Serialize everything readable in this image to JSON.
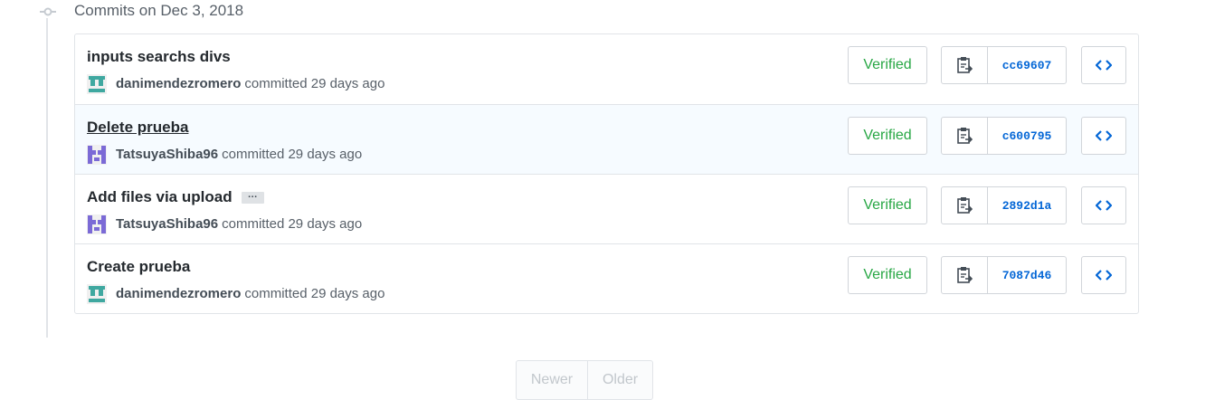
{
  "group": {
    "title": "Commits on Dec 3, 2018"
  },
  "commits": [
    {
      "message": "inputs searchs divs",
      "author": "danimendezromero",
      "committed": "committed 29 days ago",
      "verified": "Verified",
      "sha": "cc69607",
      "avatar_icon": "identicon-teal",
      "has_more": false,
      "highlighted": false
    },
    {
      "message": "Delete prueba",
      "author": "TatsuyaShiba96",
      "committed": "committed 29 days ago",
      "verified": "Verified",
      "sha": "c600795",
      "avatar_icon": "identicon-purple",
      "has_more": false,
      "highlighted": true
    },
    {
      "message": "Add files via upload",
      "author": "TatsuyaShiba96",
      "committed": "committed 29 days ago",
      "verified": "Verified",
      "sha": "2892d1a",
      "avatar_icon": "identicon-purple",
      "has_more": true,
      "more_label": "…",
      "highlighted": false
    },
    {
      "message": "Create prueba",
      "author": "danimendezromero",
      "committed": "committed 29 days ago",
      "verified": "Verified",
      "sha": "7087d46",
      "avatar_icon": "identicon-teal",
      "has_more": false,
      "highlighted": false
    }
  ],
  "pagination": {
    "newer": "Newer",
    "older": "Older"
  },
  "colors": {
    "verified": "#28a745",
    "sha_link": "#0366d6",
    "teal_avatar": "#3fa8a0",
    "purple_avatar": "#7b6ad6"
  }
}
